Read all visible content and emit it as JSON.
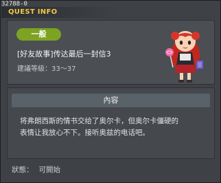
{
  "window": {
    "id_label": "32788-0",
    "title": "QUEST INFO"
  },
  "quest": {
    "category": "一般",
    "title": "[好友故事]传达最后一封信3",
    "level_label": "建議等級：33～37"
  },
  "content": {
    "header": "內容",
    "text_line1": "将弗朗西斯的情书交给了奥尔卡，但奥尔卡僵硬的",
    "text_line2": "表情让我放心不下。接听奥兹的电话吧。"
  },
  "status": {
    "label": "狀態：",
    "value": "可開始"
  },
  "colors": {
    "accent_gold": "#f2c94a",
    "badge_green": "#7da322",
    "panel_dark": "#3e4146"
  },
  "icons": {
    "close": "close-icon",
    "npc": "npc-portrait"
  }
}
